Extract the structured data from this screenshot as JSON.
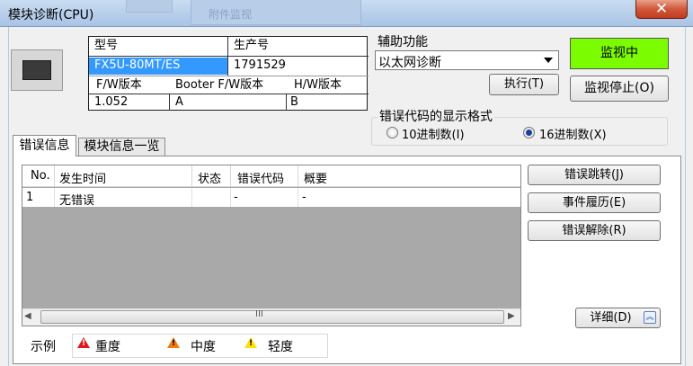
{
  "window": {
    "title": "模块诊断(CPU)",
    "background_tab_text": "附件监视",
    "close_glyph": "✕"
  },
  "module_info": {
    "model_header": "型号",
    "serial_header": "生产号",
    "model_value": "FX5U-80MT/ES",
    "serial_value": "1791529",
    "fw_header": "F/W版本",
    "booter_fw_header": "Booter F/W版本",
    "hw_header": "H/W版本",
    "fw_value": "1.052",
    "booter_fw_value": "A",
    "hw_value": "B"
  },
  "aux": {
    "label": "辅助功能",
    "selected": "以太网诊断",
    "execute_label": "执行(T)"
  },
  "monitor": {
    "status": "监视中",
    "status_color": "#7cfc00",
    "stop_label": "监视停止(O)"
  },
  "error_code_format": {
    "label": "错误代码的显示格式",
    "option_dec": "10进制数(I)",
    "option_hex": "16进制数(X)",
    "selected": "hex"
  },
  "tabs": [
    {
      "label": "错误信息",
      "active": true
    },
    {
      "label": "模块信息一览",
      "active": false
    }
  ],
  "error_table": {
    "columns": [
      "No.",
      "发生时间",
      "状态",
      "错误代码",
      "概要"
    ],
    "rows": [
      {
        "no": "1",
        "time": "无错误",
        "state": "",
        "code": "-",
        "summary": "-"
      }
    ],
    "scroll_grip": "III"
  },
  "actions": {
    "error_jump": "错误跳转(J)",
    "event_history": "事件履历(E)",
    "error_clear": "错误解除(R)",
    "detail": "详细(D)"
  },
  "legend": {
    "label": "示例",
    "major": "重度",
    "moderate": "中度",
    "minor": "轻度",
    "major_color": "#e01a1a",
    "moderate_color": "#f07a0c",
    "minor_color": "#ffe100"
  }
}
